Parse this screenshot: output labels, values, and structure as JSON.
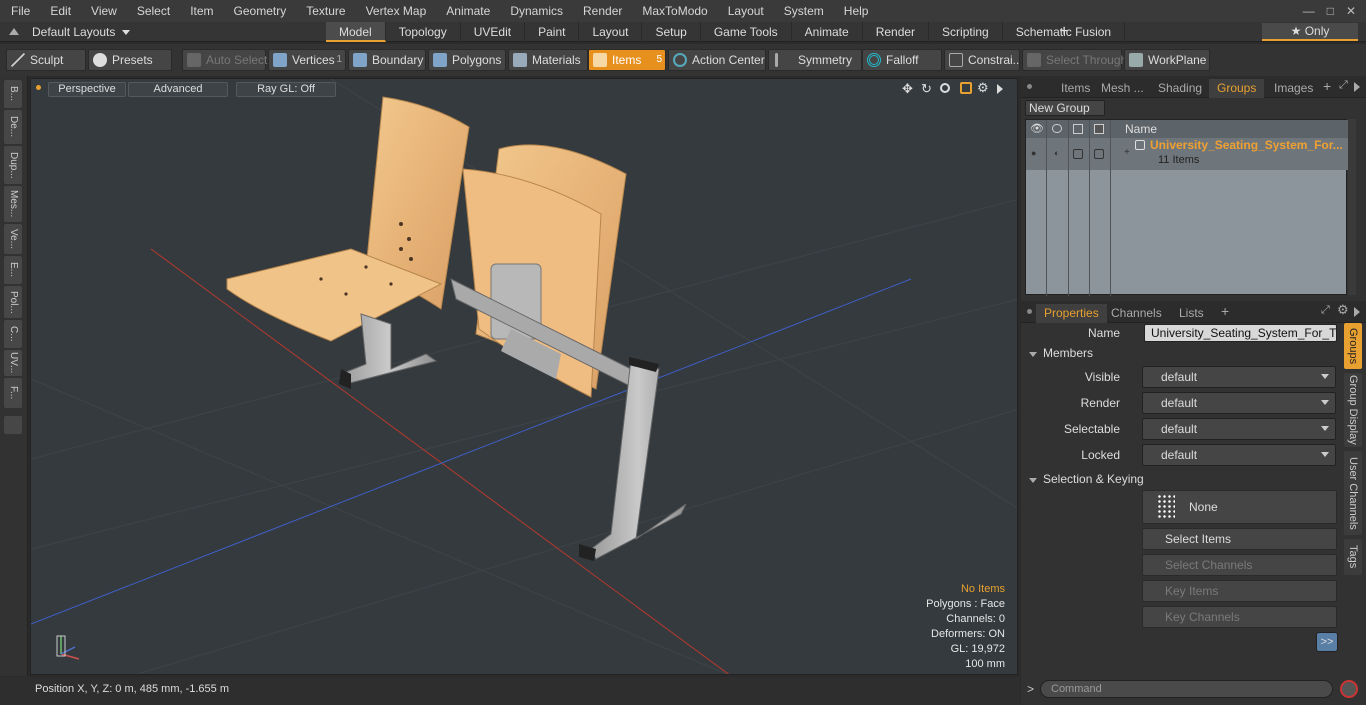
{
  "menu": [
    "File",
    "Edit",
    "View",
    "Select",
    "Item",
    "Geometry",
    "Texture",
    "Vertex Map",
    "Animate",
    "Dynamics",
    "Render",
    "MaxToModo",
    "Layout",
    "System",
    "Help"
  ],
  "window_controls": [
    "—",
    "□",
    "✕"
  ],
  "layouts": {
    "label": "Default Layouts"
  },
  "layout_tabs": [
    "Model",
    "Topology",
    "UVEdit",
    "Paint",
    "Layout",
    "Setup",
    "Game Tools",
    "Animate",
    "Render",
    "Scripting",
    "Schematic Fusion"
  ],
  "only_label": "★ Only",
  "toolbar": {
    "sculpt": "Sculpt",
    "presets": "Presets",
    "auto_select": "Auto Select",
    "vertices": "Vertices",
    "vertices_count": "1",
    "boundary": "Boundary",
    "polygons": "Polygons",
    "materials": "Materials",
    "items": "Items",
    "items_count": "5",
    "action_center": "Action Center",
    "symmetry": "Symmetry",
    "falloff": "Falloff",
    "constrain": "Constrai...",
    "select_through": "Select Through",
    "workplane": "WorkPlane"
  },
  "left_strip": [
    "B...",
    "De...",
    "Dup...",
    "Mes...",
    "Ve...",
    "E...",
    "Pol...",
    "C...",
    "UV...",
    "F..."
  ],
  "viewport": {
    "perspective": "Perspective",
    "advanced": "Advanced",
    "raygl": "Ray GL: Off",
    "info": [
      "No Items",
      "Polygons : Face",
      "Channels: 0",
      "Deformers: ON",
      "GL: 19,972",
      "100 mm"
    ],
    "accent": "#e8a030"
  },
  "status": {
    "position": "Position X, Y, Z:   0 m, 485 mm, -1.655 m"
  },
  "scene_tabs": [
    "Items",
    "Mesh ...",
    "Shading",
    "Groups",
    "Images"
  ],
  "new_group": "New Group",
  "groups_table": {
    "name_header": "Name",
    "group_name": "University_Seating_System_For...",
    "group_items": "11 Items"
  },
  "props_tabs": [
    "Properties",
    "Channels",
    "Lists"
  ],
  "properties": {
    "name_label": "Name",
    "name_value": "University_Seating_System_For_Two_",
    "members_label": "Members",
    "visible_label": "Visible",
    "render_label": "Render",
    "selectable_label": "Selectable",
    "locked_label": "Locked",
    "default_value": "default",
    "sel_keying_label": "Selection & Keying",
    "none_label": "None",
    "select_items": "Select Items",
    "select_channels": "Select Channels",
    "key_items": "Key Items",
    "key_channels": "Key Channels",
    "more": ">>"
  },
  "side_tabs": [
    "Groups",
    "Group Display",
    "User Channels",
    "Tags"
  ],
  "command": {
    "placeholder": "Command",
    "prompt": ">"
  }
}
